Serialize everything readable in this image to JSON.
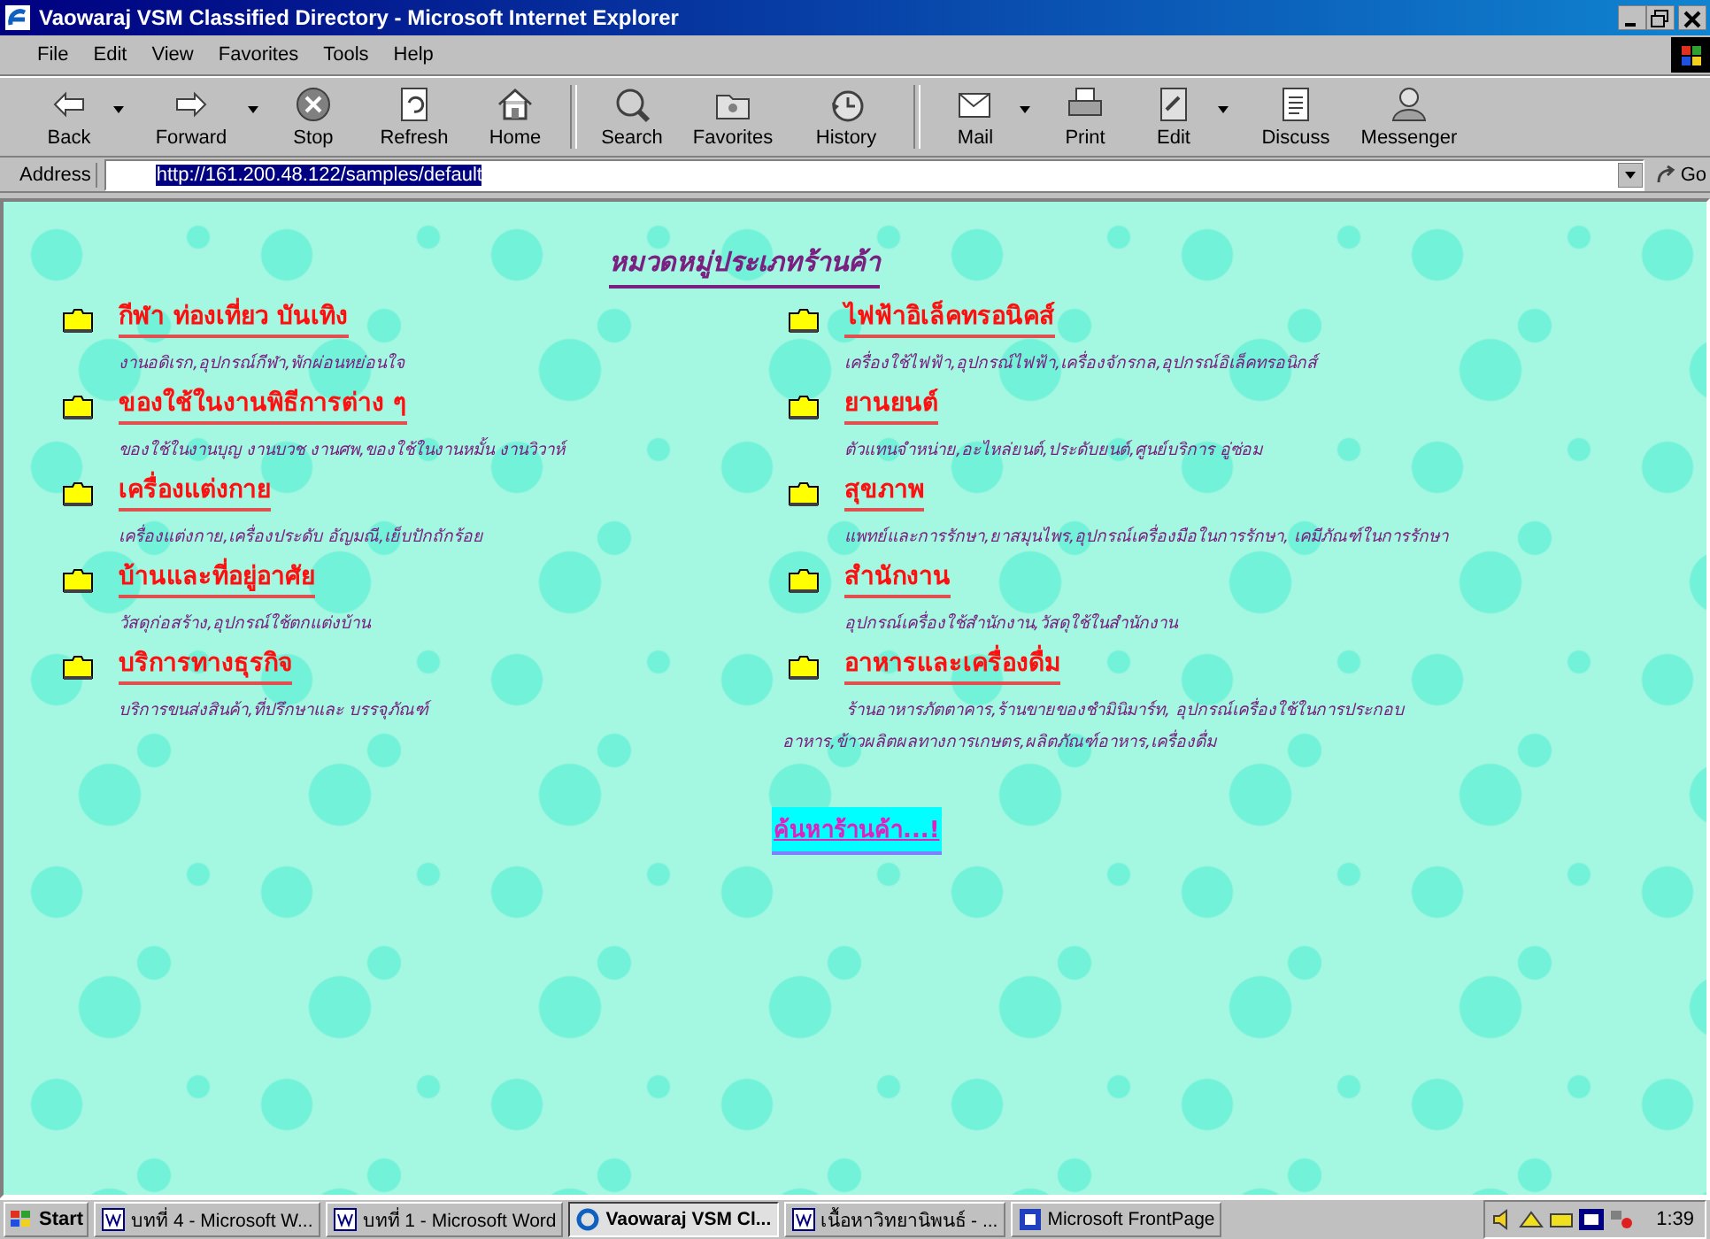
{
  "window": {
    "title": "Vaowaraj VSM Classified Directory - Microsoft Internet Explorer"
  },
  "menu": [
    "File",
    "Edit",
    "View",
    "Favorites",
    "Tools",
    "Help"
  ],
  "toolbar": [
    {
      "label": "Back",
      "has_menu": true
    },
    {
      "label": "Forward",
      "has_menu": true
    },
    {
      "label": "Stop",
      "has_menu": false
    },
    {
      "label": "Refresh",
      "has_menu": false
    },
    {
      "label": "Home",
      "has_menu": false
    },
    {
      "label": "Search",
      "has_menu": false
    },
    {
      "label": "Favorites",
      "has_menu": false
    },
    {
      "label": "History",
      "has_menu": false
    },
    {
      "label": "Mail",
      "has_menu": true
    },
    {
      "label": "Print",
      "has_menu": false
    },
    {
      "label": "Edit",
      "has_menu": true
    },
    {
      "label": "Discuss",
      "has_menu": false
    },
    {
      "label": "Messenger",
      "has_menu": false
    }
  ],
  "address": {
    "label": "Address",
    "value": "http://161.200.48.122/samples/default",
    "go": "Go"
  },
  "page": {
    "title": "หมวดหมู่ประเภทร้านค้า",
    "columns": [
      [
        {
          "name": "กีฬา ท่องเที่ยว บันเทิง",
          "description": "งานอดิเรก,อุปกรณ์กีฬา,พักผ่อนหย่อนใจ"
        },
        {
          "name": "ของใช้ในงานพิธีการต่าง ๆ",
          "description": "ของใช้ในงานบุญ งานบวช งานศพ,ของใช้ในงานหมั้น งานวิวาห์"
        },
        {
          "name": "เครื่องแต่งกาย",
          "description": "เครื่องแต่งกาย,เครื่องประดับ อัญมณี,เย็บปักถักร้อย"
        },
        {
          "name": "บ้านและที่อยู่อาศัย",
          "description": "วัสดุก่อสร้าง,อุปกรณ์ใช้ตกแต่งบ้าน"
        },
        {
          "name": "บริการทางธุรกิจ",
          "description": "บริการขนส่งสินค้า,ที่ปรึกษาและ บรรจุภัณฑ์"
        }
      ],
      [
        {
          "name": "ไฟฟ้าอิเล็คทรอนิคส์",
          "description": "เครื่องใช้ไฟฟ้า,อุปกรณ์ไฟฟ้า,เครื่องจักรกล,อุปกรณ์อิเล็คทรอนิกส์"
        },
        {
          "name": "ยานยนต์",
          "description": "ตัวแทนจำหน่าย,อะไหล่ยนต์,ประดับยนต์,ศูนย์บริการ อู่ซ่อม"
        },
        {
          "name": "สุขภาพ",
          "description": "แพทย์และการรักษา,ยาสมุนไพร,อุปกรณ์เครื่องมือในการรักษา, เคมีภัณฑ์ในการรักษา"
        },
        {
          "name": "สำนักงาน",
          "description": "อุปกรณ์เครื่องใช้สำนักงาน,วัสดุใช้ในสำนักงาน"
        },
        {
          "name": "อาหารและเครื่องดื่ม",
          "description": "ร้านอาหารภัตตาคาร,ร้านขายของชำมินิมาร์ท, อุปกรณ์เครื่องใช้ในการประกอบอาหาร,ข้าวผลิตผลทางการเกษตร,ผลิตภัณฑ์อาหาร,เครื่องดื่ม"
        }
      ]
    ],
    "search_link": "ค้นหาร้านค้า...!"
  },
  "taskbar": {
    "start": "Start",
    "tasks": [
      {
        "label": "บทที่ 4 - Microsoft W...",
        "selected": false
      },
      {
        "label": "บทที่ 1 - Microsoft Word",
        "selected": false
      },
      {
        "label": "Vaowaraj VSM Cl...",
        "selected": true
      },
      {
        "label": "เนื้อหาวิทยานิพนธ์ - ...",
        "selected": false
      },
      {
        "label": "Microsoft FrontPage",
        "selected": false
      }
    ],
    "clock": "1:39"
  }
}
